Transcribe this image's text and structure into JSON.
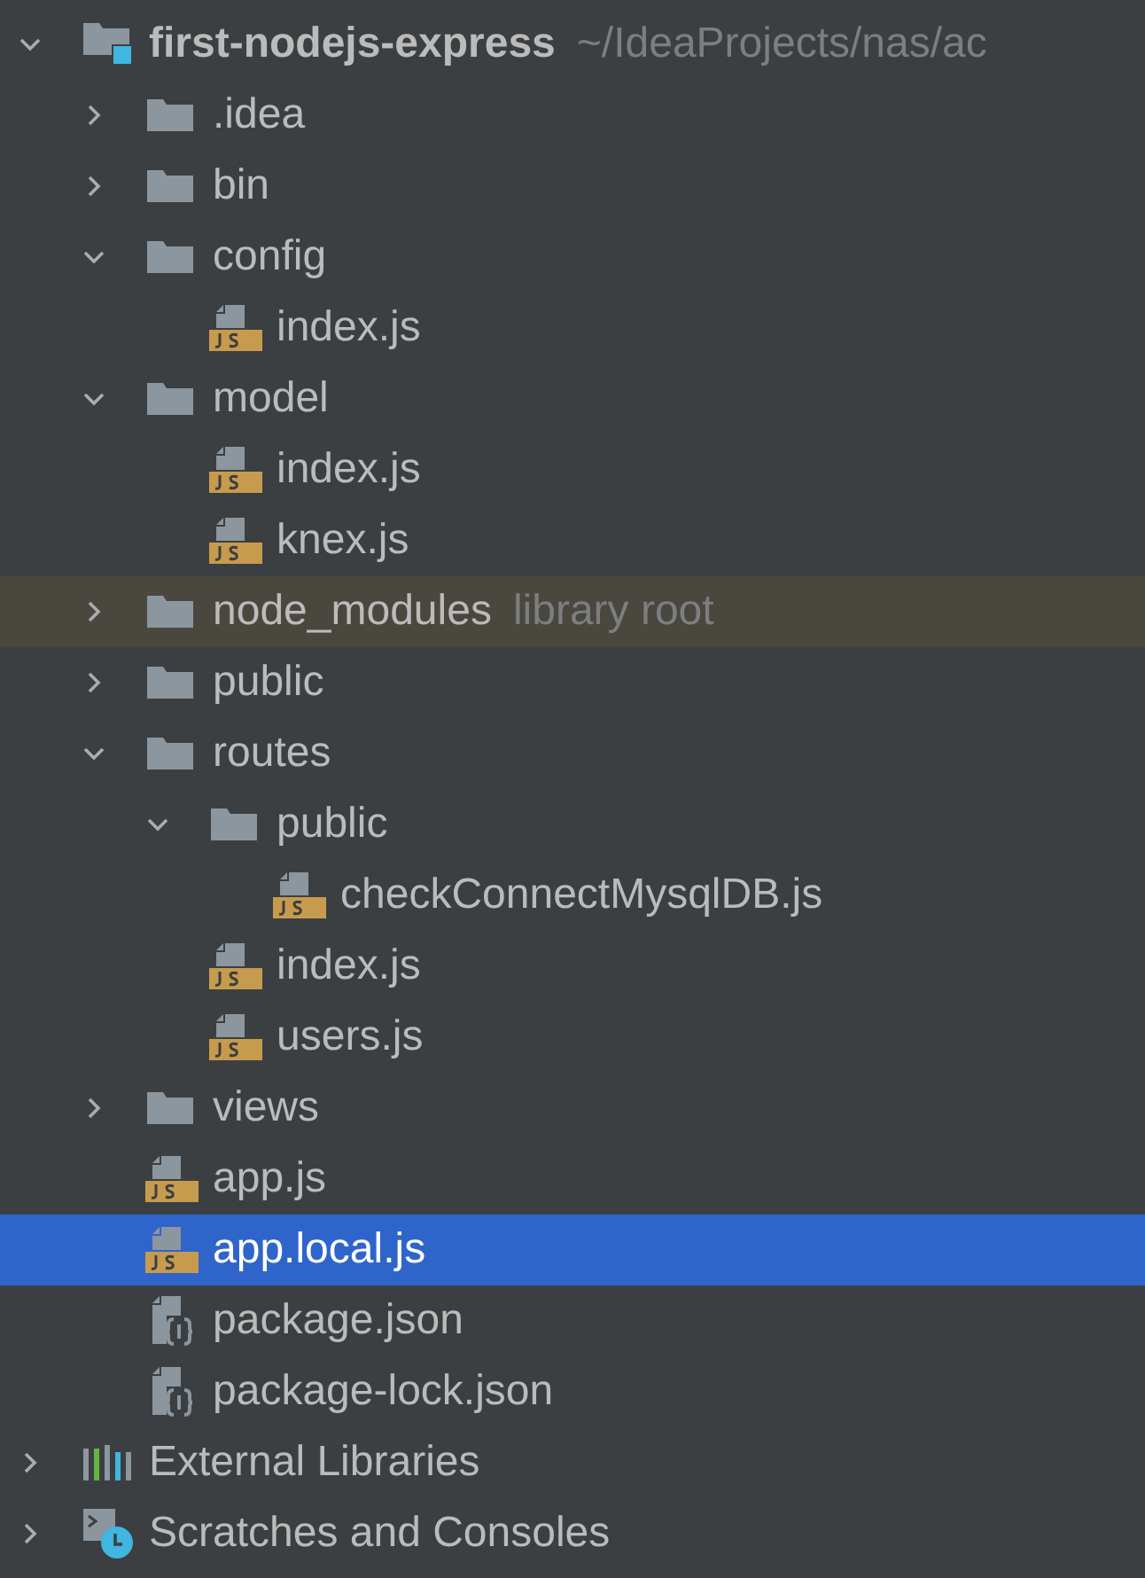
{
  "tree": [
    {
      "name": "first-nodejs-express",
      "kind": "project",
      "path": "~/IdeaProjects/nas/ac",
      "expanded": true,
      "selected": false,
      "children": [
        {
          "name": ".idea",
          "kind": "folder",
          "expanded": false,
          "selected": false
        },
        {
          "name": "bin",
          "kind": "folder",
          "expanded": false,
          "selected": false
        },
        {
          "name": "config",
          "kind": "folder",
          "expanded": true,
          "selected": false,
          "children": [
            {
              "name": "index.js",
              "kind": "js",
              "selected": false
            }
          ]
        },
        {
          "name": "model",
          "kind": "folder",
          "expanded": true,
          "selected": false,
          "children": [
            {
              "name": "index.js",
              "kind": "js",
              "selected": false
            },
            {
              "name": "knex.js",
              "kind": "js",
              "selected": false
            }
          ]
        },
        {
          "name": "node_modules",
          "kind": "folder",
          "hint": "library root",
          "highlighted": true,
          "expanded": false,
          "selected": false
        },
        {
          "name": "public",
          "kind": "folder",
          "expanded": false,
          "selected": false
        },
        {
          "name": "routes",
          "kind": "folder",
          "expanded": true,
          "selected": false,
          "children": [
            {
              "name": "public",
              "kind": "folder",
              "expanded": true,
              "selected": false,
              "children": [
                {
                  "name": "checkConnectMysqlDB.js",
                  "kind": "js",
                  "selected": false
                }
              ]
            },
            {
              "name": "index.js",
              "kind": "js",
              "selected": false
            },
            {
              "name": "users.js",
              "kind": "js",
              "selected": false
            }
          ]
        },
        {
          "name": "views",
          "kind": "folder",
          "expanded": false,
          "selected": false
        },
        {
          "name": "app.js",
          "kind": "js",
          "selected": false
        },
        {
          "name": "app.local.js",
          "kind": "js",
          "selected": true
        },
        {
          "name": "package.json",
          "kind": "json",
          "selected": false
        },
        {
          "name": "package-lock.json",
          "kind": "json",
          "selected": false
        }
      ]
    },
    {
      "name": "External Libraries",
      "kind": "libraries",
      "expanded": false,
      "selected": false
    },
    {
      "name": "Scratches and Consoles",
      "kind": "scratches",
      "expanded": false,
      "selected": false
    }
  ]
}
